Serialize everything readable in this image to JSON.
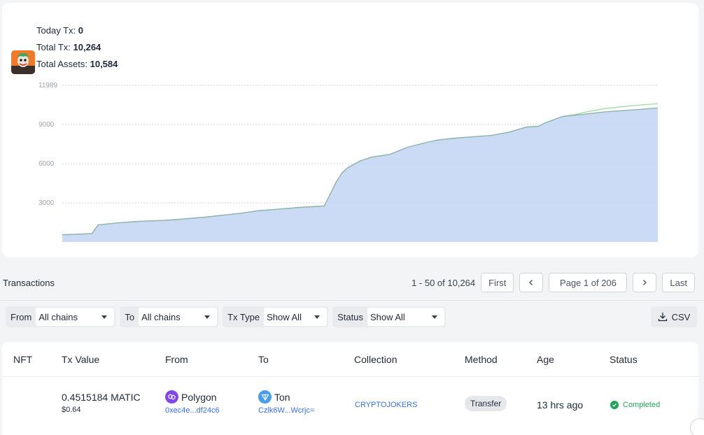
{
  "stats": {
    "today_label": "Today Tx:",
    "today_value": "0",
    "total_tx_label": "Total Tx:",
    "total_tx_value": "10,264",
    "total_assets_label": "Total Assets:",
    "total_assets_value": "10,584"
  },
  "chart_data": {
    "type": "area",
    "ylim": [
      0,
      11989
    ],
    "yticks": [
      "11989",
      "9000",
      "6000",
      "3000"
    ],
    "grid": true,
    "x": [
      0,
      3,
      5,
      6,
      9,
      12,
      14,
      17,
      20,
      24,
      27,
      30,
      33,
      36,
      40,
      44,
      46,
      47,
      48,
      50,
      52,
      55,
      58,
      61,
      63,
      66,
      69,
      72,
      75,
      78,
      80,
      81,
      84,
      86,
      88,
      91,
      94,
      97,
      100
    ],
    "series": [
      {
        "values": [
          550,
          600,
          650,
          1300,
          1450,
          1550,
          1600,
          1650,
          1750,
          1900,
          2050,
          2200,
          2400,
          2500,
          2650,
          2750,
          4600,
          5300,
          5700,
          6200,
          6500,
          6700,
          7250,
          7600,
          7800,
          7950,
          8050,
          8150,
          8400,
          8800,
          8850,
          9100,
          9600,
          9700,
          9800,
          9950,
          10050,
          10150,
          10264
        ]
      },
      {
        "values": [
          550,
          600,
          650,
          1300,
          1450,
          1550,
          1600,
          1650,
          1750,
          1900,
          2050,
          2200,
          2400,
          2500,
          2650,
          2750,
          4600,
          5300,
          5700,
          6200,
          6500,
          6700,
          7250,
          7600,
          7800,
          7950,
          8050,
          8150,
          8400,
          8800,
          8850,
          9100,
          9600,
          9750,
          9950,
          10200,
          10350,
          10480,
          10584
        ]
      }
    ]
  },
  "colors": {
    "series_tx": "#8fb3a8",
    "series_assets": "#9fdca6",
    "area_fill": "#c5d7f5",
    "link": "#3b6fd8",
    "success": "#22a35a"
  },
  "transactions": {
    "title": "Transactions",
    "range_text": "1 - 50 of 10,264",
    "first_label": "First",
    "page_label": "Page 1 of 206",
    "last_label": "Last",
    "prev_icon": "chevron-left-icon",
    "next_icon": "chevron-right-icon"
  },
  "filters": {
    "from_label": "From",
    "from_value": "All chains",
    "to_label": "To",
    "to_value": "All chains",
    "txtype_label": "Tx Type",
    "txtype_value": "Show All",
    "status_label": "Status",
    "status_value": "Show All",
    "csv_label": "CSV"
  },
  "table": {
    "headers": [
      "NFT",
      "Tx Value",
      "From",
      "To",
      "Collection",
      "Method",
      "Age",
      "Status"
    ],
    "rows": [
      {
        "tx_value": "0.4515184 MATIC",
        "tx_usd": "$0.64",
        "from_chain": "Polygon",
        "from_addr": "0xec4e...df24c6",
        "to_chain": "Ton",
        "to_addr": "Czlk6W...Wcrjc=",
        "collection": "CRYPTOJOKERS",
        "method": "Transfer",
        "age": "13 hrs ago",
        "status": "Completed"
      }
    ]
  }
}
